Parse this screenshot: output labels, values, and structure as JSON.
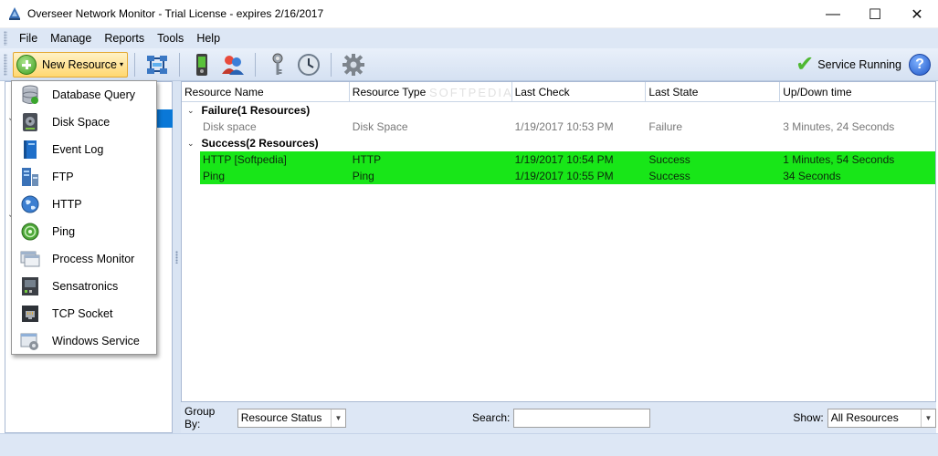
{
  "window": {
    "title": "Overseer Network Monitor - Trial License - expires 2/16/2017",
    "minimize_glyph": "—",
    "maximize_glyph": "☐",
    "close_glyph": "✕"
  },
  "menu": {
    "items": [
      "File",
      "Manage",
      "Reports",
      "Tools",
      "Help"
    ]
  },
  "toolbar": {
    "new_resource_label": "New Resource",
    "caret": "▾",
    "service_status": "Service Running",
    "help_glyph": "?",
    "icons": [
      "network-icon",
      "device-icon",
      "users-icon",
      "key-icon",
      "clock-icon",
      "gear-icon"
    ]
  },
  "tree": {
    "chevron": "⌄"
  },
  "grid": {
    "columns": [
      "Resource Name",
      "Resource Type",
      "Last Check",
      "Last State",
      "Up/Down time"
    ],
    "groups": [
      {
        "label": "Failure(1 Resources)",
        "state": "fail",
        "rows": [
          [
            "Disk space",
            "Disk Space",
            "1/19/2017 10:53 PM",
            "Failure",
            "3 Minutes, 24 Seconds"
          ]
        ]
      },
      {
        "label": "Success(2 Resources)",
        "state": "ok",
        "rows": [
          [
            "HTTP [Softpedia]",
            "HTTP",
            "1/19/2017 10:54 PM",
            "Success",
            "1 Minutes, 54 Seconds"
          ],
          [
            "Ping",
            "Ping",
            "1/19/2017 10:55 PM",
            "Success",
            "34 Seconds"
          ]
        ]
      }
    ],
    "group_chevron": "⌄"
  },
  "filterbar": {
    "group_by_label": "Group By:",
    "group_by_value": "Resource Status",
    "search_label": "Search:",
    "search_value": "",
    "show_label": "Show:",
    "show_value": "All Resources",
    "dropdown_glyph": "▼"
  },
  "new_resource_menu": {
    "items": [
      {
        "label": "Database Query",
        "icon": "database-icon"
      },
      {
        "label": "Disk Space",
        "icon": "disk-icon"
      },
      {
        "label": "Event Log",
        "icon": "book-icon"
      },
      {
        "label": "FTP",
        "icon": "ftp-server-icon"
      },
      {
        "label": "HTTP",
        "icon": "globe-icon"
      },
      {
        "label": "Ping",
        "icon": "ping-icon"
      },
      {
        "label": "Process Monitor",
        "icon": "windows-icon"
      },
      {
        "label": "Sensatronics",
        "icon": "sensor-icon"
      },
      {
        "label": "TCP Socket",
        "icon": "socket-icon"
      },
      {
        "label": "Windows Service",
        "icon": "service-icon"
      }
    ]
  },
  "watermark": "SOFTPEDIA",
  "colors": {
    "success_row": "#18e618",
    "selection": "#0a78d7",
    "chrome": "#dde7f5"
  }
}
